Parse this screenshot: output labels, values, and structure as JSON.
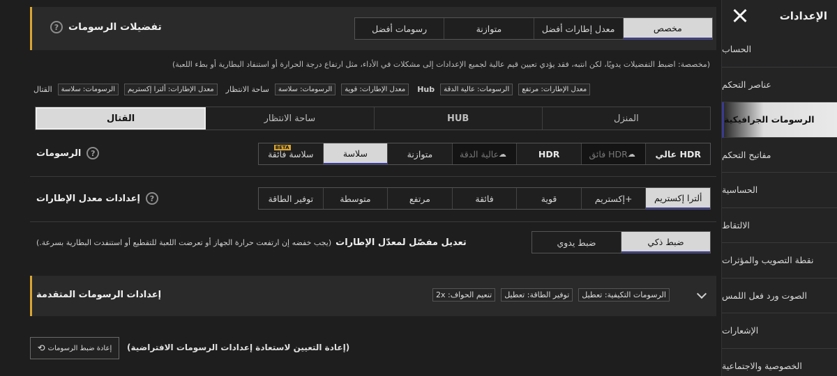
{
  "sidebar": {
    "title": "الإعدادات",
    "items": [
      {
        "label": "الحساب"
      },
      {
        "label": "عناصر التحكم"
      },
      {
        "label": "الرسومات الجرافيكية"
      },
      {
        "label": "مفاتيح التحكم"
      },
      {
        "label": "الحساسية"
      },
      {
        "label": "الالتقاط"
      },
      {
        "label": "نقطة التصويب والمؤثرات"
      },
      {
        "label": "الصوت ورد فعل اللمس"
      },
      {
        "label": "الإشعارات"
      },
      {
        "label": "الخصوصية والاجتماعية"
      }
    ],
    "active_index": 2
  },
  "prefs": {
    "title": "تفضيلات الرسومات",
    "options": [
      "مخصص",
      "معدل إطارات أفضل",
      "متوازنة",
      "رسومات أفضل"
    ],
    "note": "(مخصصة: اضبط التفضيلات يدويًا، لكن انتبه، فقد يؤدي تعيين قيم عالية لجميع الإعدادات إلى مشكلات في الأداء، مثل ارتفاع درجة الحرارة أو استنفاد البطارية أو بطء اللعبة)",
    "summary": {
      "combat": "القتال",
      "combat_gfx": "الرسومات: سلاسة",
      "combat_fps": "معدل الإطارات: ألترا إكستريم",
      "lobby": "ساحة الانتظار",
      "lobby_gfx": "الرسومات: سلاسة",
      "lobby_fps": "معدل الإطارات: قوية",
      "hub": "Hub",
      "hub_gfx": "الرسومات: عالية الدقة",
      "hub_fps": "معدل الإطارات: مرتفع"
    }
  },
  "scene_tabs": [
    "القتال",
    "ساحة الانتظار",
    "HUB",
    "المنزل"
  ],
  "graphics": {
    "label": "الرسومات",
    "options": [
      "سلاسة فائقة",
      "سلاسة",
      "متوازنة",
      "عالية الدقة",
      "HDR",
      "فائق HDR",
      "عالي HDR"
    ],
    "beta": "BETA"
  },
  "fps": {
    "label": "إعدادات معدل الإطارات",
    "options": [
      "توفير الطاقة",
      "متوسطة",
      "مرتفع",
      "فائقة",
      "قوية",
      "إكستريم+",
      "ألترا إكستريم"
    ]
  },
  "adaptive": {
    "label": "تعديل مفصّل لمعدّل الإطارات",
    "hint": "(يجب خفضه إن ارتفعت حرارة الجهاز أو تعرضت اللعبة للتقطيع أو استنفدت البطارية بسرعة.)",
    "options": [
      "ضبط يدوي",
      "ضبط ذكي"
    ]
  },
  "advanced": {
    "title": "إعدادات الرسومات المتقدمة",
    "chips": [
      "الرسومات التكيفية: تعطيل",
      "توفير الطاقة: تعطيل",
      "تنعيم الحواف: 2x"
    ]
  },
  "reset": {
    "button": "إعادة ضبط الرسومات",
    "note": "(إعادة التعيين لاستعادة إعدادات الرسومات الافتراضية)"
  }
}
